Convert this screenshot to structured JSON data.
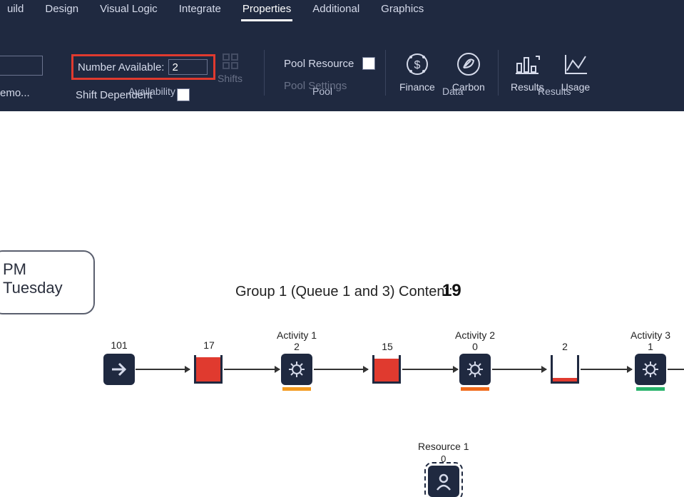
{
  "tabs": {
    "t0": "uild",
    "t1": "Design",
    "t2": "Visual Logic",
    "t3": "Integrate",
    "t4": "Properties",
    "t5": "Additional",
    "t6": "Graphics"
  },
  "ribbon": {
    "memo": "emo...",
    "number_available_label": "Number Available:",
    "number_available_value": "2",
    "shift_dependent_label": "Shift Dependent",
    "shifts_label": "Shifts",
    "availability_group": "Availability",
    "pool_resource_label": "Pool Resource",
    "pool_settings_label": "Pool Settings",
    "pool_group": "Pool",
    "finance_label": "Finance",
    "carbon_label": "Carbon",
    "data_group": "Data",
    "results_label": "Results",
    "usage_label": "Usage",
    "results_group": "Results"
  },
  "clock": {
    "line1": "PM",
    "line2": "Tuesday"
  },
  "content": {
    "label": "Group 1 (Queue 1 and 3) Content:",
    "value": "19"
  },
  "flow": {
    "entry_count": "101",
    "queue1_count": "17",
    "activity1_label": "Activity 1",
    "activity1_count": "2",
    "queue2_count": "15",
    "activity2_label": "Activity 2",
    "activity2_count": "0",
    "queue3_count": "2",
    "activity3_label": "Activity 3",
    "activity3_count": "1"
  },
  "resource": {
    "label": "Resource 1",
    "count": "0"
  },
  "colors": {
    "accent_red": "#e03a2f",
    "orange": "#f39a1f",
    "green": "#27b36a"
  }
}
